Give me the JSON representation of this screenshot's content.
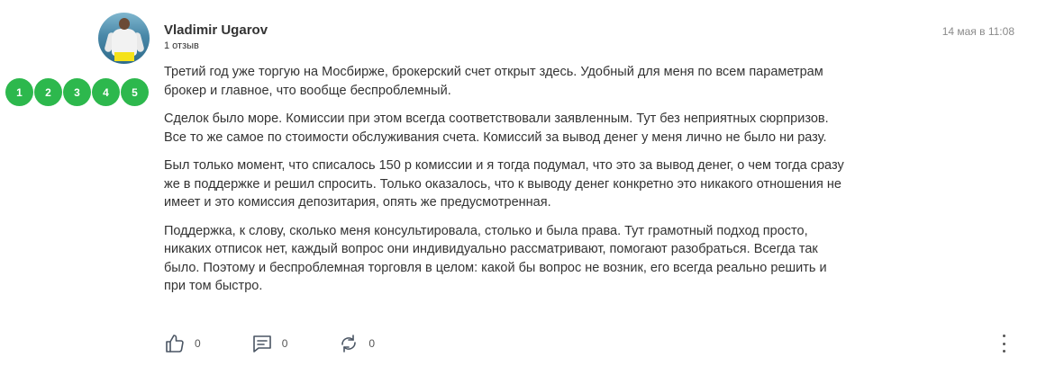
{
  "author": {
    "name": "Vladimir Ugarov",
    "reviews_count": "1 отзыв"
  },
  "date": "14 мая в 11:08",
  "rating": {
    "options": [
      "1",
      "2",
      "3",
      "4",
      "5"
    ],
    "color": "#2db84d"
  },
  "body": {
    "paragraphs": [
      "Третий год уже торгую на Мосбирже, брокерский счет открыт здесь. Удобный для меня по всем параметрам брокер и главное, что вообще беспроблемный.",
      "Сделок было море. Комиссии при этом всегда соответствовали заявленным. Тут без неприятных сюрпризов. Все то же самое по стоимости обслуживания счета. Комиссий за вывод денег у меня лично не было ни разу.",
      "Был только момент, что списалось 150 р комиссии и я тогда подумал, что это за вывод денег, о чем тогда сразу же в поддержке и решил спросить. Только оказалось, что к выводу денег конкретно это никакого отношения не имеет и это комиссия депозитария, опять же предусмотренная.",
      "Поддержка, к слову, сколько меня консультировала, столько и была права. Тут грамотный подход просто, никаких отписок нет, каждый вопрос они индивидуально рассматривают, помогают разобраться. Всегда так было. Поэтому и беспроблемная торговля в целом: какой бы вопрос не возник, его всегда реально решить и при том быстро."
    ]
  },
  "actions": {
    "likes": {
      "icon": "thumbs-up-icon",
      "count": "0"
    },
    "comments": {
      "icon": "comment-icon",
      "count": "0"
    },
    "reposts": {
      "icon": "repost-icon",
      "count": "0"
    },
    "more": {
      "icon": "more-vertical-icon"
    }
  }
}
